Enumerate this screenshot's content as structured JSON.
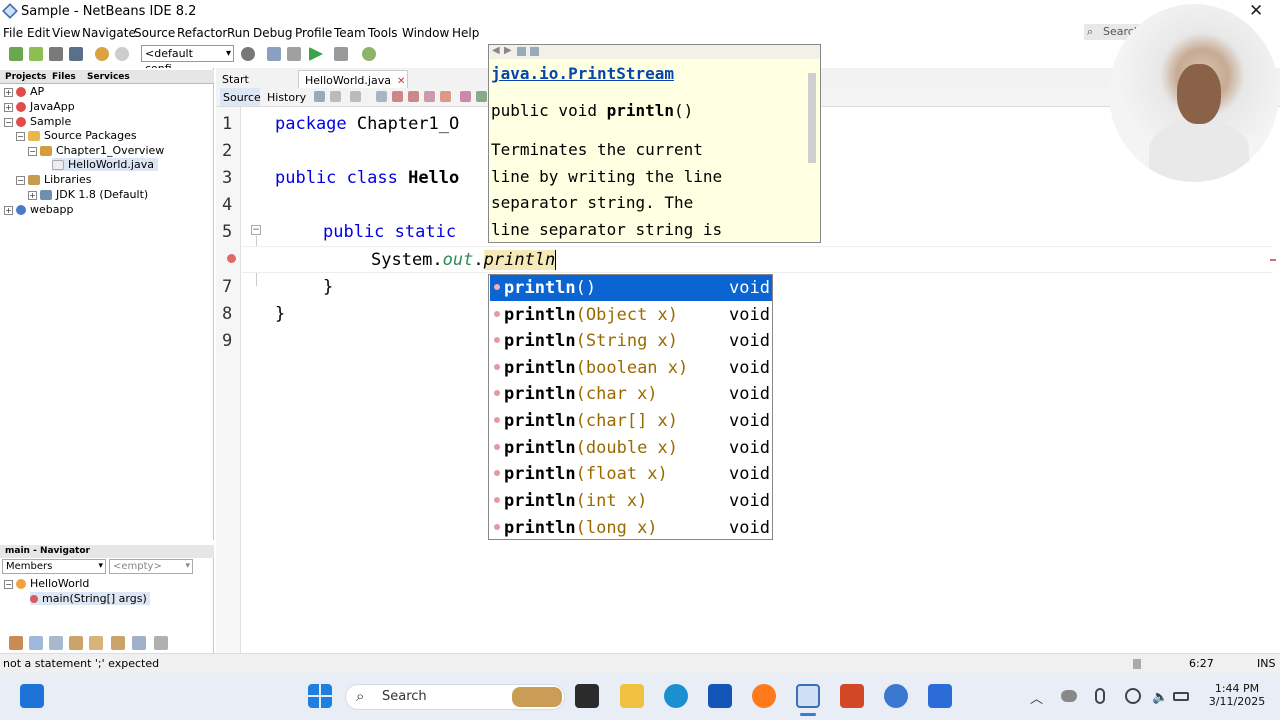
{
  "window": {
    "title": "Sample - NetBeans IDE 8.2"
  },
  "menu": [
    "File",
    "Edit",
    "View",
    "Navigate",
    "Source",
    "Refactor",
    "Run",
    "Debug",
    "Profile",
    "Team",
    "Tools",
    "Window",
    "Help"
  ],
  "search": {
    "placeholder": "Search"
  },
  "toolbar": {
    "config_value": "<default confi..."
  },
  "left_tabs": [
    "Projects",
    "Files",
    "Services"
  ],
  "tree": [
    {
      "label": "AP"
    },
    {
      "label": "JavaApp"
    },
    {
      "label": "Sample"
    },
    {
      "label": "Source Packages"
    },
    {
      "label": "Chapter1_Overview"
    },
    {
      "label": "HelloWorld.java"
    },
    {
      "label": "Libraries"
    },
    {
      "label": "JDK 1.8 (Default)"
    },
    {
      "label": "webapp"
    }
  ],
  "navigator": {
    "tab": "main - Navigator",
    "members_select": "Members",
    "empty_select": "<empty>",
    "class_name": "HelloWorld",
    "method": "main(String[] args)"
  },
  "editor": {
    "tabs": [
      "Start Page",
      "HelloWorld.java"
    ],
    "source_btn": "Source",
    "history_btn": "History",
    "line_numbers": [
      "1",
      "2",
      "3",
      "4",
      "5",
      "6",
      "7",
      "8",
      "9"
    ],
    "lines": {
      "l1_kw": "package",
      "l1_rest": " Chapter1_O",
      "l3_kw1": "public",
      "l3_kw2": " class",
      "l3_name": " Hello",
      "l5_kw1": "public",
      "l5_kw2": " static",
      "l6_a": "System.",
      "l6_b": "out",
      "l6_c": ".",
      "l6_d": "println",
      "l7": "}",
      "l8": "}"
    }
  },
  "javadoc": {
    "class": "java.io.PrintStream",
    "signature_pre": "public void ",
    "signature_name": "println",
    "signature_post": "()",
    "description": "Terminates the current\nline by writing the line\nseparator string. The\nline separator string is"
  },
  "completion": [
    {
      "name": "println",
      "params": "()",
      "ret": "void"
    },
    {
      "name": "println",
      "params": "(Object x)",
      "ret": "void"
    },
    {
      "name": "println",
      "params": "(String x)",
      "ret": "void"
    },
    {
      "name": "println",
      "params": "(boolean x)",
      "ret": "void"
    },
    {
      "name": "println",
      "params": "(char x)",
      "ret": "void"
    },
    {
      "name": "println",
      "params": "(char[] x)",
      "ret": "void"
    },
    {
      "name": "println",
      "params": "(double x)",
      "ret": "void"
    },
    {
      "name": "println",
      "params": "(float x)",
      "ret": "void"
    },
    {
      "name": "println",
      "params": "(int x)",
      "ret": "void"
    },
    {
      "name": "println",
      "params": "(long x)",
      "ret": "void"
    }
  ],
  "status": {
    "message": "not a statement ';' expected",
    "position": "6:27",
    "mode": "INS"
  },
  "taskbar": {
    "search": "Search",
    "time": "1:44 PM",
    "date": "3/11/2025"
  },
  "colors": {
    "accent": "#0a64d2",
    "doc_bg": "#ffffe1",
    "keyword": "#0000e6"
  }
}
